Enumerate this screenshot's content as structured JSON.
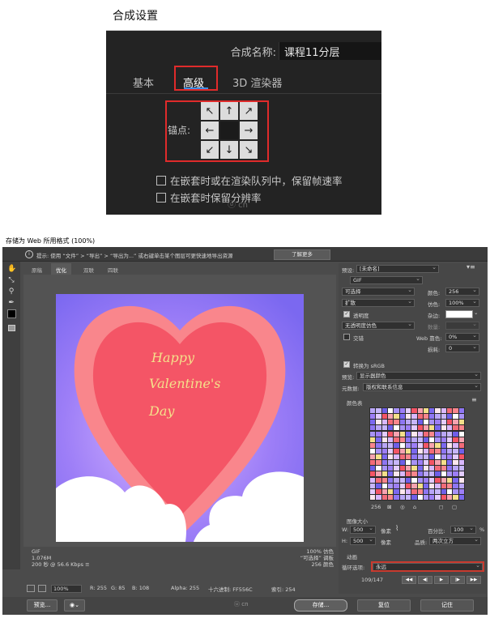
{
  "comp": {
    "title": "合成设置",
    "name_label": "合成名称:",
    "name_value": "课程11分层",
    "tabs": [
      "基本",
      "高级",
      "3D 渲染器"
    ],
    "anchor_label": "锚点:",
    "anchor_arrows": [
      "↖",
      "↑",
      "↗",
      "←",
      "",
      "→",
      "↙",
      "↓",
      "↘"
    ],
    "checkbox1": "在嵌套时或在渲染队列中，保留帧速率",
    "checkbox2": "在嵌套时保留分辨率",
    "watermark": "ⓤ cn"
  },
  "web": {
    "title": "存储为 Web 所用格式 (100%)",
    "tip": "提示: 使用 “文件” > “导出” > “导出为...” 或右键单击某个图层可更快速地导出资源",
    "learn_more": "了解更多",
    "view_tabs": [
      "原稿",
      "优化",
      "双联",
      "四联"
    ],
    "image_text": [
      "Happy",
      "Valentine's",
      "Day"
    ],
    "info_left": [
      "GIF",
      "1.076M",
      "200 秒 @ 56.6 Kbps ≡"
    ],
    "info_right": [
      "100% 仿色",
      "“可选择” 调板",
      "256 颜色"
    ],
    "status": {
      "zoom": "100%",
      "r": "R: 255",
      "g": "G: 85",
      "b": "B: 108",
      "alpha": "Alpha: 255",
      "hex": "十六进制: FF556C",
      "index": "索引: 254"
    },
    "buttons": {
      "preview": "预览...",
      "save": "存储...",
      "reset": "复位",
      "remember": "记住"
    },
    "watermark": "ⓤ cn",
    "panel": {
      "preset_label": "预设:",
      "preset_value": "[未命名]",
      "format": "GIF",
      "reduction": "可选择",
      "colors_label": "颜色:",
      "colors_value": "256",
      "dither_algo": "扩散",
      "dither_label": "仿色:",
      "dither_value": "100%",
      "transparency": "透明度",
      "matte_label": "杂边:",
      "trans_dither": "无透明度仿色",
      "amount_label": "数量:",
      "interlaced": "交错",
      "web_snap_label": "Web 靠色:",
      "web_snap_value": "0%",
      "lossy_label": "损耗:",
      "lossy_value": "0",
      "convert_srgb": "转换为 sRGB",
      "preview_label": "预览:",
      "preview_value": "显示器颜色",
      "metadata_label": "元数据:",
      "metadata_value": "版权和联系信息",
      "color_table_title": "颜色表",
      "color_count": "256",
      "image_size_title": "图像大小",
      "w_label": "W:",
      "w_value": "500",
      "h_label": "H:",
      "h_value": "500",
      "unit": "像素",
      "percent_label": "百分比:",
      "percent_value": "100",
      "percent_unit": "%",
      "quality_label": "品质:",
      "quality_value": "两次立方",
      "animation_title": "动画",
      "loop_label": "循环选项:",
      "loop_value": "永远",
      "frame_counter": "109/147",
      "nav": [
        "◀◀",
        "◀|",
        "▶",
        "|▶",
        "▶▶"
      ]
    }
  }
}
